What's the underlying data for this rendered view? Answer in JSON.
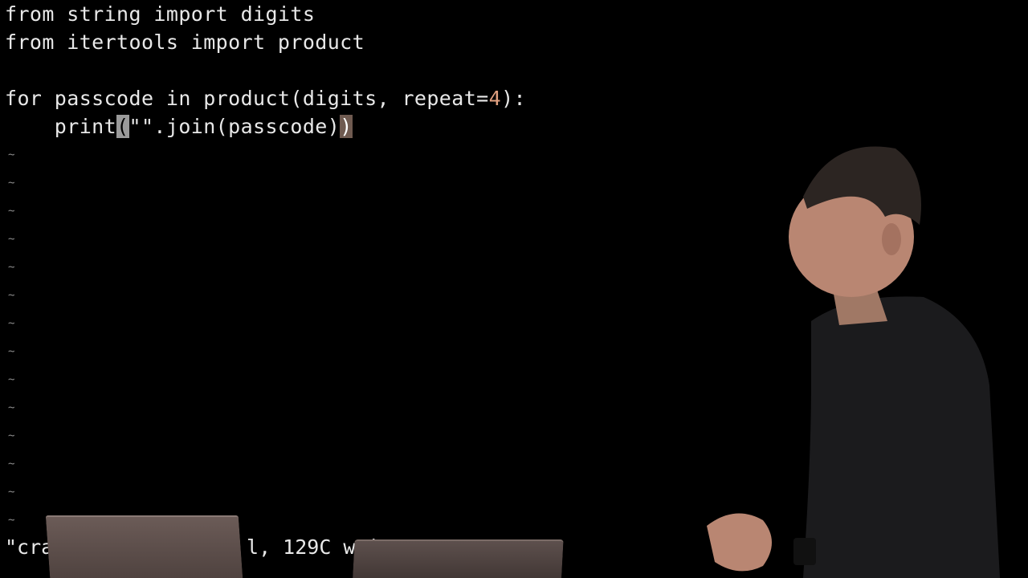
{
  "editor": {
    "lines": [
      "from string import digits",
      "from itertools import product",
      "",
      "for passcode in product(digits, repeat=4):",
      "    print(\"\".join(passcode))"
    ],
    "line4_parts": {
      "before": "for passcode in product(digits, repeat=",
      "number": "4",
      "after": "):"
    },
    "line5_parts": {
      "indent": "    print",
      "cursor_char": "(",
      "middle": "\"\".join(passcode)",
      "match_char": ")"
    },
    "empty_line_marker": "~",
    "empty_line_count": 14
  },
  "statusline": {
    "text": "\"crac        .   ,  l, 129C wri"
  },
  "colors": {
    "background": "#000000",
    "text": "#e8e8e8",
    "number": "#e0a080",
    "cursor_bg": "#9a9a9a",
    "match_bg": "#6f5a50",
    "tilde": "#8a8a8a"
  }
}
